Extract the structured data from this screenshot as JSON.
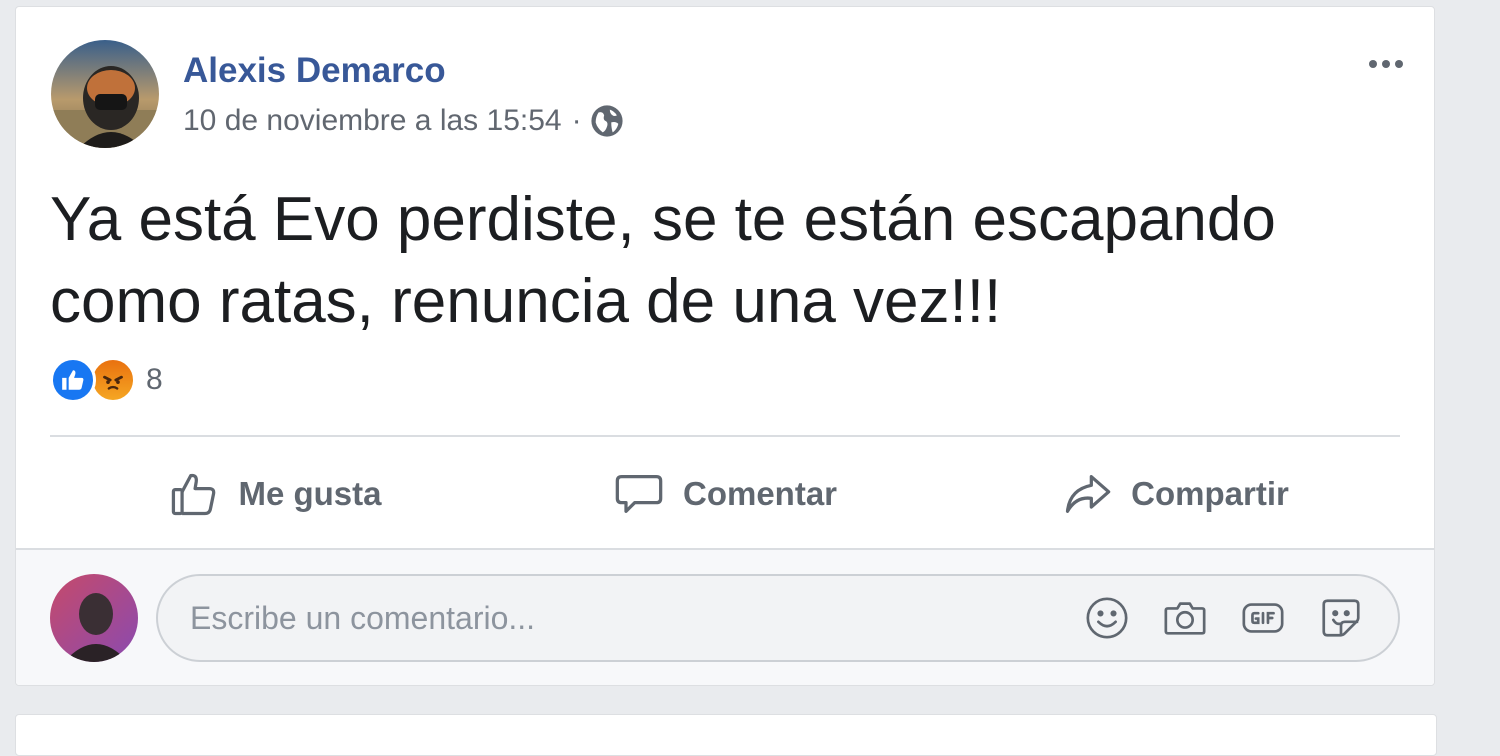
{
  "post": {
    "author": "Alexis Demarco",
    "timestamp": "10 de noviembre a las 15:54",
    "separator": "·",
    "privacy_icon": "globe-icon",
    "text": "Ya está Evo perdiste, se te están escapando como ratas, renuncia de una vez!!!",
    "reactions": {
      "types": [
        "like-icon",
        "angry-icon"
      ],
      "count": "8"
    }
  },
  "actions": {
    "like_label": "Me gusta",
    "comment_label": "Comentar",
    "share_label": "Compartir"
  },
  "comment_composer": {
    "placeholder": "Escribe un comentario...",
    "tools": [
      "emoji-icon",
      "camera-icon",
      "gif-icon",
      "sticker-icon"
    ]
  },
  "colors": {
    "link_blue": "#385898",
    "like_blue": "#1877f2",
    "angry_orange": "#e9710f",
    "text": "#1c1e21",
    "secondary_text": "#606770",
    "page_background": "#e9ebee"
  }
}
